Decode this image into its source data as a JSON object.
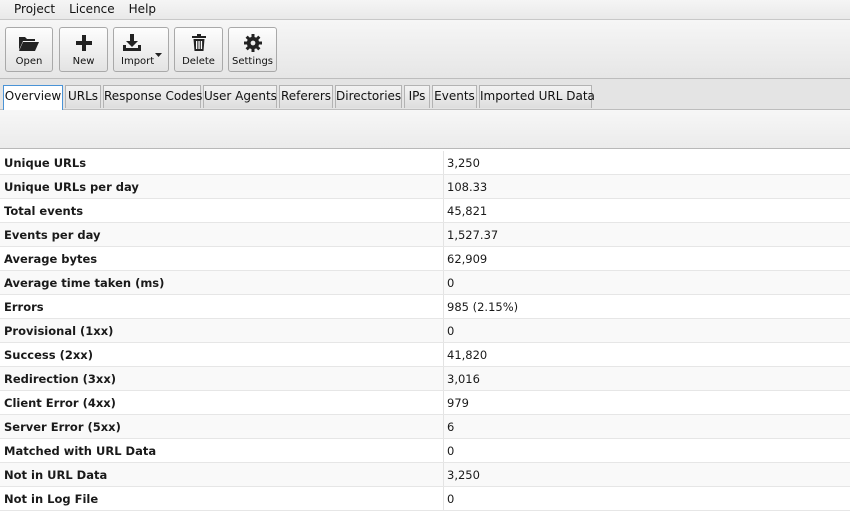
{
  "menu": {
    "items": [
      "Project",
      "Licence",
      "Help"
    ]
  },
  "toolbar": {
    "open_label": "Open",
    "new_label": "New",
    "import_label": "Import",
    "delete_label": "Delete",
    "settings_label": "Settings"
  },
  "tabs": [
    {
      "label": "Overview",
      "active": true
    },
    {
      "label": "URLs"
    },
    {
      "label": "Response Codes"
    },
    {
      "label": "User Agents"
    },
    {
      "label": "Referers"
    },
    {
      "label": "Directories"
    },
    {
      "label": "IPs"
    },
    {
      "label": "Events"
    },
    {
      "label": "Imported URL Data"
    }
  ],
  "stats": [
    {
      "label": "Unique URLs",
      "value": "3,250"
    },
    {
      "label": "Unique URLs per day",
      "value": "108.33"
    },
    {
      "label": "Total events",
      "value": "45,821"
    },
    {
      "label": "Events per day",
      "value": "1,527.37"
    },
    {
      "label": "Average bytes",
      "value": "62,909"
    },
    {
      "label": "Average time taken (ms)",
      "value": "0"
    },
    {
      "label": "Errors",
      "value": "985 (2.15%)"
    },
    {
      "label": "Provisional (1xx)",
      "value": "0"
    },
    {
      "label": "Success (2xx)",
      "value": "41,820"
    },
    {
      "label": "Redirection (3xx)",
      "value": "3,016"
    },
    {
      "label": "Client Error (4xx)",
      "value": "979"
    },
    {
      "label": "Server Error (5xx)",
      "value": "6"
    },
    {
      "label": "Matched with URL Data",
      "value": "0"
    },
    {
      "label": "Not in URL Data",
      "value": "3,250"
    },
    {
      "label": "Not in Log File",
      "value": "0"
    }
  ],
  "icons": {
    "open": "folder-open-icon",
    "new": "plus-icon",
    "import": "download-icon",
    "delete": "trash-icon",
    "settings": "gear-icon"
  },
  "colors": {
    "active_tab_border": "#4a93d6",
    "icon": "#222222"
  }
}
